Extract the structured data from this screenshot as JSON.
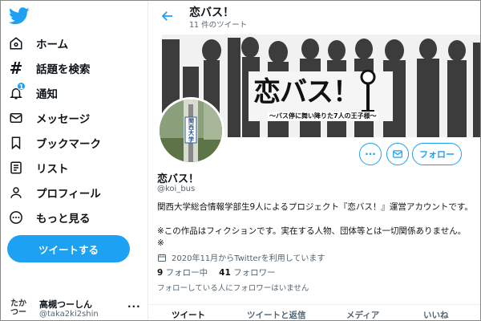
{
  "colors": {
    "accent": "#1da1f2",
    "text": "#0f1419",
    "muted": "#536471"
  },
  "sidebar": {
    "logo": "twitter-bird-icon",
    "items": [
      {
        "icon": "home-icon",
        "label": "ホーム"
      },
      {
        "icon": "hashtag-icon",
        "label": "話題を検索"
      },
      {
        "icon": "bell-icon",
        "label": "通知",
        "badge": "1"
      },
      {
        "icon": "mail-icon",
        "label": "メッセージ"
      },
      {
        "icon": "bookmark-icon",
        "label": "ブックマーク"
      },
      {
        "icon": "list-icon",
        "label": "リスト"
      },
      {
        "icon": "person-icon",
        "label": "プロフィール"
      },
      {
        "icon": "more-circle-icon",
        "label": "もっと見る"
      }
    ],
    "tweet_button": "ツイートする",
    "account": {
      "avatar_text": "たか\nつー",
      "name": "高槻つーしん",
      "handle": "@taka2ki2shin",
      "more": "···"
    }
  },
  "header": {
    "title": "恋バス！",
    "subtitle": "11 件のツイート"
  },
  "banner": {
    "title": "恋バス！",
    "tagline": "〜バス停に舞い降りた7人の王子様〜"
  },
  "avatar": {
    "sign": "関西大学"
  },
  "actions": {
    "more": "···",
    "follow": "フォロー"
  },
  "profile": {
    "name": "恋バス！",
    "handle": "@koi_bus",
    "bio": [
      "関西大学総合情報学部生9人によるプロジェクト『恋バス！』運営アカウントです。",
      "",
      "※この作品はフィクションです。実在する人物、団体等とは一切関係ありません。",
      "※"
    ],
    "joined": "2020年11月からTwitterを利用しています",
    "following_count": "9",
    "following_label": "フォロー中",
    "followers_count": "41",
    "followers_label": "フォロワー",
    "followed_note": "フォローしている人にフォロワーはいません"
  },
  "tabs": [
    "ツイート",
    "ツイートと返信",
    "メディア",
    "いいね"
  ]
}
